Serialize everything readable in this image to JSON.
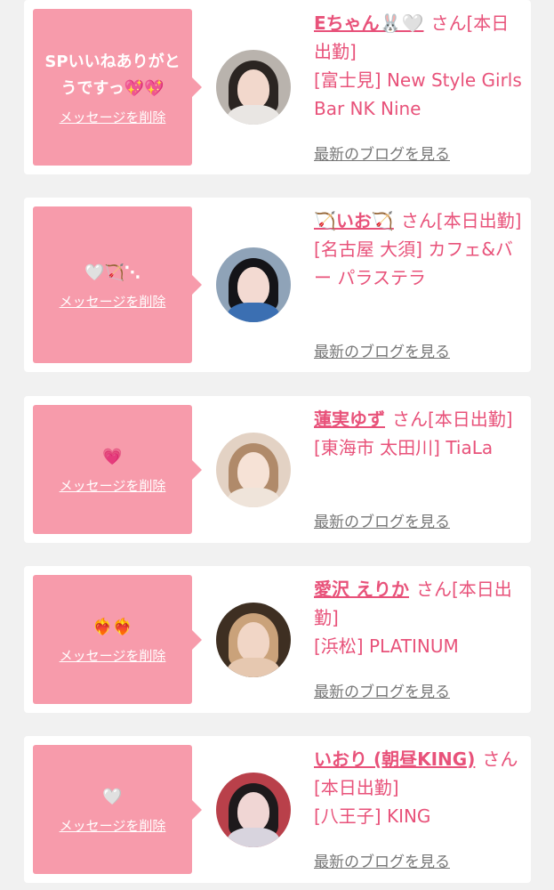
{
  "cards": [
    {
      "message": "SPいいねありがとうですっ💖💖",
      "delete_label": "メッセージを削除",
      "name": "Eちゃん🐰🤍",
      "suffix": "さん[本日出勤]",
      "shop": "[富士見] New Style Girls Bar NK Nine",
      "blog_label": "最新のブログを見る",
      "avatar_colors": {
        "bg": "#b9b3ad",
        "hair": "#2b2522",
        "face": "#f2d8cc",
        "body": "#e9e6e3"
      }
    },
    {
      "message": "🤍🏹⋱",
      "delete_label": "メッセージを削除",
      "name": "🏹いお🏹",
      "suffix": "さん[本日出勤]",
      "shop": "[名古屋 大須] カフェ&バー パラステラ",
      "blog_label": "最新のブログを見る",
      "avatar_colors": {
        "bg": "#8fa3b8",
        "hair": "#141418",
        "face": "#f3dad2",
        "body": "#3b6fb2"
      }
    },
    {
      "message": "💗",
      "delete_label": "メッセージを削除",
      "name": "蓮実ゆず",
      "suffix": "さん[本日出勤]",
      "shop": "[東海市 太田川] TiaLa",
      "blog_label": "最新のブログを見る",
      "avatar_colors": {
        "bg": "#e3d2c4",
        "hair": "#b08a6a",
        "face": "#f6e2d6",
        "body": "#efe4da"
      }
    },
    {
      "message": "❤️‍🔥❤️‍🔥",
      "delete_label": "メッセージを削除",
      "name": "愛沢 えりか",
      "suffix": "さん[本日出勤]",
      "shop": "[浜松] PLATINUM",
      "blog_label": "最新のブログを見る",
      "avatar_colors": {
        "bg": "#3e2f22",
        "hair": "#caa27a",
        "face": "#f1d6c6",
        "body": "#e6c8b0"
      }
    },
    {
      "message": "🤍",
      "delete_label": "メッセージを削除",
      "name": "いおり (朝昼KING)",
      "suffix": "さん[本日出勤]",
      "shop": "[八王子] KING",
      "blog_label": "最新のブログを見る",
      "avatar_colors": {
        "bg": "#b9404a",
        "hair": "#1e1a1c",
        "face": "#f0d6d4",
        "body": "#d8d4de"
      }
    }
  ]
}
